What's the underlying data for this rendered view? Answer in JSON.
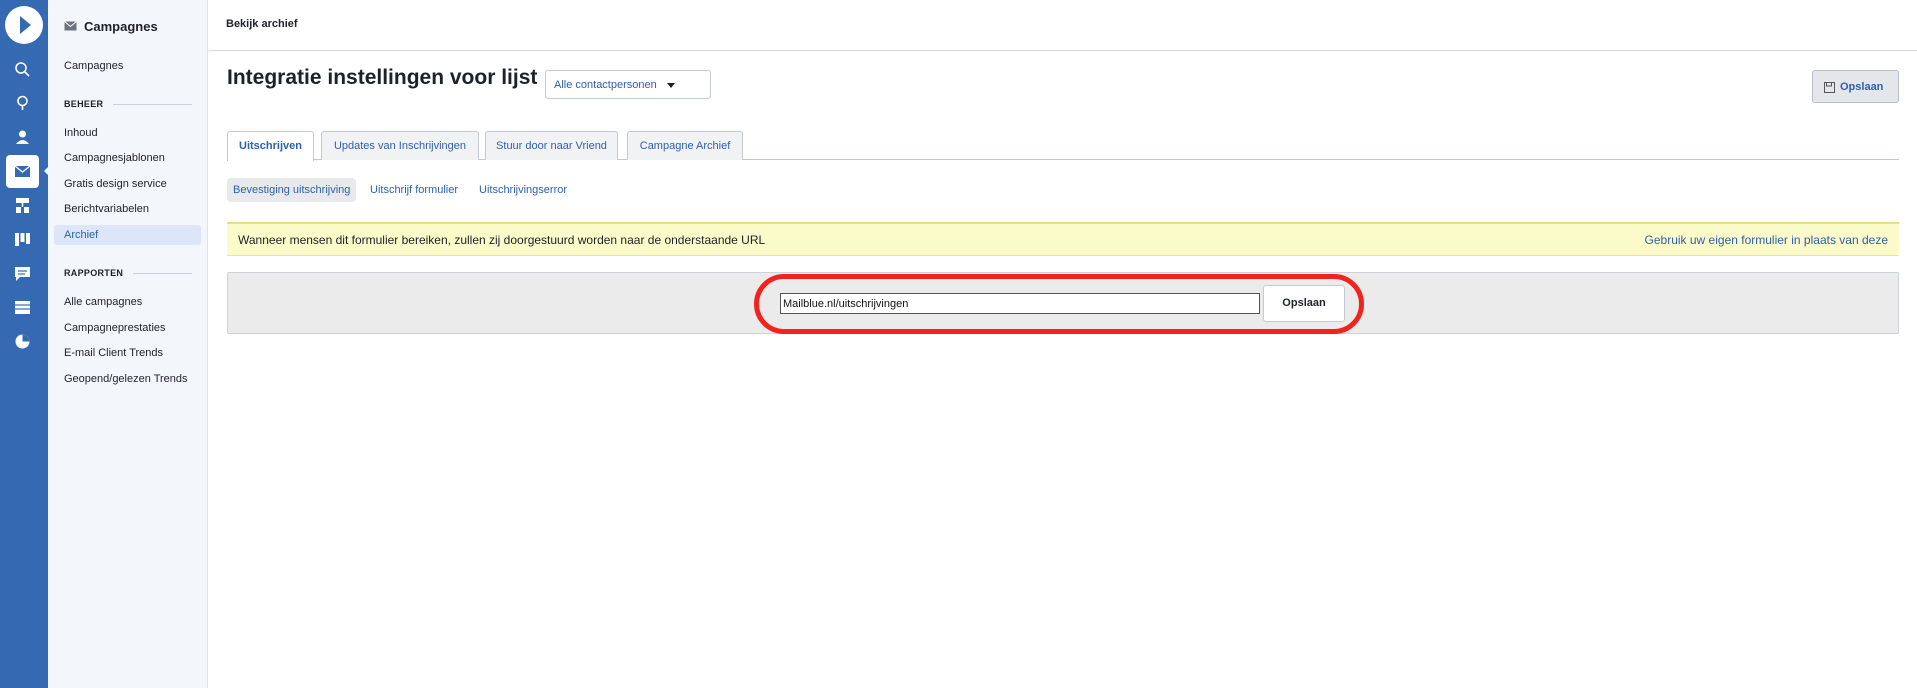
{
  "app": {
    "nav_icons": [
      "logo-icon",
      "search-icon",
      "lightbulb-icon",
      "contacts-icon",
      "campaigns-icon",
      "automations-icon",
      "deals-icon",
      "conversations-icon",
      "site-icon",
      "reports-icon"
    ]
  },
  "sidebar": {
    "title": "Campagnes",
    "top_link": "Campagnes",
    "section_beheer": "BEHEER",
    "beheer_items": [
      "Inhoud",
      "Campagnesjablonen",
      "Gratis design service",
      "Berichtvariabelen",
      "Archief"
    ],
    "active_item": "Archief",
    "section_rapporten": "RAPPORTEN",
    "rapporten_items": [
      "Alle campagnes",
      "Campagneprestaties",
      "E-mail Client Trends",
      "Geopend/gelezen Trends"
    ]
  },
  "topbar": {
    "title": "Bekijk archief"
  },
  "page": {
    "title": "Integratie instellingen voor lijst",
    "list_select": "Alle contactpersonen",
    "save_label": "Opslaan"
  },
  "tabs": [
    "Uitschrijven",
    "Updates van Inschrijvingen",
    "Stuur door naar Vriend",
    "Campagne Archief"
  ],
  "subtabs": [
    "Bevestiging uitschrijving",
    "Uitschrijf formulier",
    "Uitschrijvingserror"
  ],
  "banner": {
    "text": "Wanneer mensen dit formulier bereiken, zullen zij doorgestuurd worden naar de onderstaande URL",
    "link": "Gebruik uw eigen formulier in plaats van deze"
  },
  "form": {
    "url_value": "Mailblue.nl/uitschrijvingen",
    "save_label": "Opslaan"
  },
  "colors": {
    "rail": "#356ab3",
    "link": "#2e60b0",
    "highlight": "#f0231f",
    "banner": "#fbfbc9"
  }
}
